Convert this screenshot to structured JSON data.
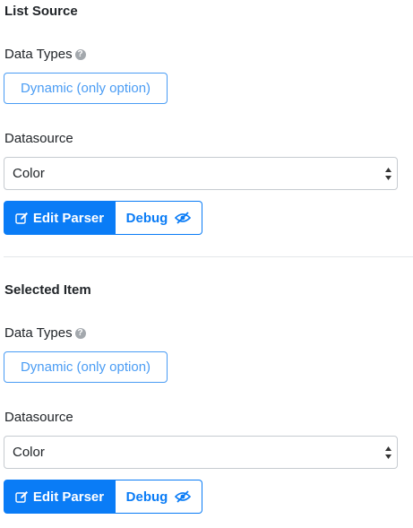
{
  "list_source": {
    "title": "List Source",
    "data_types_label": "Data Types",
    "help_glyph": "?",
    "dynamic_button": "Dynamic (only option)",
    "datasource_label": "Datasource",
    "datasource_value": "Color",
    "edit_parser": "Edit Parser",
    "debug": "Debug"
  },
  "selected_item": {
    "title": "Selected Item",
    "data_types_label": "Data Types",
    "help_glyph": "?",
    "dynamic_button": "Dynamic (only option)",
    "datasource_label": "Datasource",
    "datasource_value": "Color",
    "edit_parser": "Edit Parser",
    "debug": "Debug"
  },
  "icons": {
    "help": "question-circle-icon",
    "edit": "edit-icon",
    "debug": "eye-slash-icon",
    "select": "select-arrows-icon"
  },
  "colors": {
    "primary": "#0a7cf6",
    "outline_blue": "#4a9cf4",
    "help_gray": "#a3a8ad"
  }
}
